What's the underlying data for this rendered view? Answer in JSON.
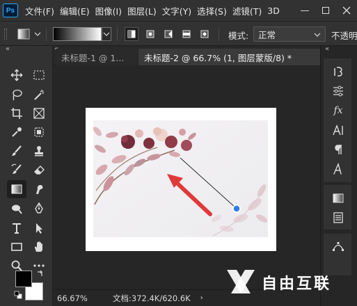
{
  "app": {
    "logo_text": "Ps"
  },
  "menubar": {
    "items": [
      "文件(F)",
      "编辑(E)",
      "图像(I)",
      "图层(L)",
      "文字(Y)",
      "选择(S)",
      "滤镜(T)",
      "3D"
    ],
    "window_buttons": [
      "minimize-icon",
      "restore-icon",
      "close-icon"
    ]
  },
  "options": {
    "mode_label": "模式:",
    "mode_value": "正常",
    "opacity_label": "不透明"
  },
  "tabs": [
    {
      "label": "未标题-1 @ 1...",
      "active": false
    },
    {
      "label": "未标题-2 @ 66.7% (1, 图层蒙版/8) *",
      "active": true
    }
  ],
  "status": {
    "zoom": "66.67%",
    "doc_info": "文档:372.4K/620.6K"
  },
  "colors": {
    "foreground": "#000000",
    "background": "#ffffff",
    "arrow": "#e0393a",
    "gradient_handle": "#2f7de1"
  },
  "watermark": {
    "text": "自由互联"
  }
}
